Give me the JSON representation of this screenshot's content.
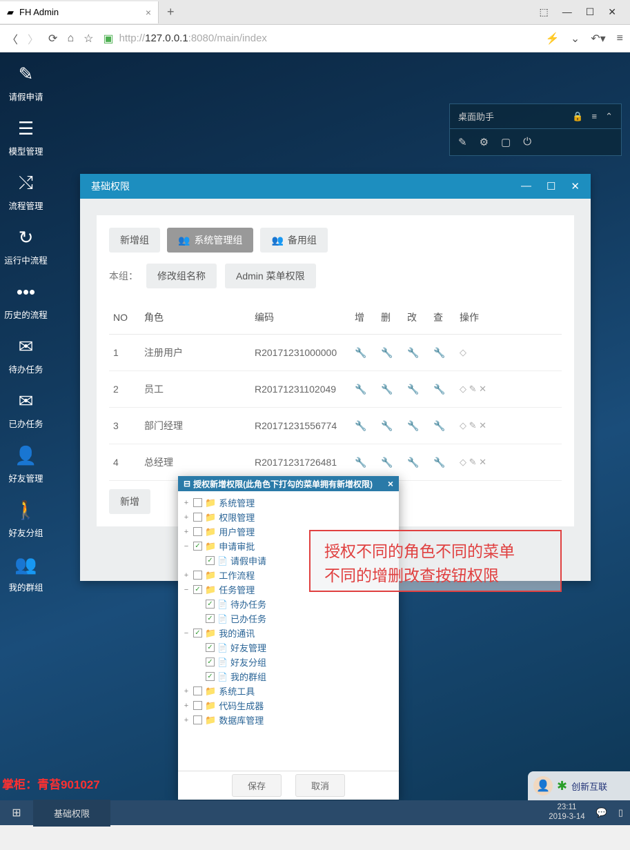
{
  "browser": {
    "tab_title": "FH Admin",
    "url": "http://127.0.0.1:8080/main/index",
    "url_prefix": "http://",
    "url_host": "127.0.0.1",
    "url_path": ":8080/main/index"
  },
  "sidebar": {
    "items": [
      {
        "label": "请假申请",
        "icon": "edit-icon"
      },
      {
        "label": "模型管理",
        "icon": "server-icon"
      },
      {
        "label": "流程管理",
        "icon": "shuffle-icon"
      },
      {
        "label": "运行中流程",
        "icon": "refresh-icon"
      },
      {
        "label": "历史的流程",
        "icon": "dots-icon"
      },
      {
        "label": "待办任务",
        "icon": "envelope-icon"
      },
      {
        "label": "已办任务",
        "icon": "envelope-open-icon"
      },
      {
        "label": "好友管理",
        "icon": "user-icon"
      },
      {
        "label": "好友分组",
        "icon": "person-icon"
      },
      {
        "label": "我的群组",
        "icon": "users-icon"
      }
    ]
  },
  "helper": {
    "title": "桌面助手"
  },
  "window": {
    "title": "基础权限",
    "tabs": {
      "new_group": "新增组",
      "sys_admin": "系统管理组",
      "backup": "备用组"
    },
    "group_label": "本组：",
    "rename": "修改组名称",
    "admin_menu": "Admin 菜单权限",
    "columns": {
      "no": "NO",
      "role": "角色",
      "code": "编码",
      "add": "增",
      "del": "删",
      "mod": "改",
      "view": "查",
      "op": "操作"
    },
    "rows": [
      {
        "no": "1",
        "role": "注册用户",
        "code": "R20171231000000",
        "ops": "tag"
      },
      {
        "no": "2",
        "role": "员工",
        "code": "R20171231102049",
        "ops": "tag-edit-del"
      },
      {
        "no": "3",
        "role": "部门经理",
        "code": "R20171231556774",
        "ops": "tag-edit-del"
      },
      {
        "no": "4",
        "role": "总经理",
        "code": "R20171231726481",
        "ops": "tag-edit-del"
      }
    ],
    "add_new": "新增"
  },
  "modal": {
    "title": "授权新增权限(此角色下打勾的菜单拥有新增权限)",
    "save": "保存",
    "cancel": "取消",
    "tree": [
      {
        "label": "系统管理",
        "indent": 0,
        "checked": false,
        "exp": "+",
        "type": "folder"
      },
      {
        "label": "权限管理",
        "indent": 0,
        "checked": false,
        "exp": "+",
        "type": "folder"
      },
      {
        "label": "用户管理",
        "indent": 0,
        "checked": false,
        "exp": "+",
        "type": "folder"
      },
      {
        "label": "申请审批",
        "indent": 0,
        "checked": true,
        "exp": "−",
        "type": "folder"
      },
      {
        "label": "请假申请",
        "indent": 1,
        "checked": true,
        "exp": "",
        "type": "file"
      },
      {
        "label": "工作流程",
        "indent": 0,
        "checked": false,
        "exp": "+",
        "type": "folder"
      },
      {
        "label": "任务管理",
        "indent": 0,
        "checked": true,
        "exp": "−",
        "type": "folder"
      },
      {
        "label": "待办任务",
        "indent": 1,
        "checked": true,
        "exp": "",
        "type": "file"
      },
      {
        "label": "已办任务",
        "indent": 1,
        "checked": true,
        "exp": "",
        "type": "file"
      },
      {
        "label": "我的通讯",
        "indent": 0,
        "checked": true,
        "exp": "−",
        "type": "folder"
      },
      {
        "label": "好友管理",
        "indent": 1,
        "checked": true,
        "exp": "",
        "type": "file"
      },
      {
        "label": "好友分组",
        "indent": 1,
        "checked": true,
        "exp": "",
        "type": "file"
      },
      {
        "label": "我的群组",
        "indent": 1,
        "checked": true,
        "exp": "",
        "type": "file"
      },
      {
        "label": "系统工具",
        "indent": 0,
        "checked": false,
        "exp": "+",
        "type": "folder"
      },
      {
        "label": "代码生成器",
        "indent": 0,
        "checked": false,
        "exp": "+",
        "type": "folder"
      },
      {
        "label": "数据库管理",
        "indent": 0,
        "checked": false,
        "exp": "+",
        "type": "folder"
      }
    ]
  },
  "annotation": {
    "line1": "授权不同的角色不同的菜单",
    "line2": "不同的增删改查按钮权限"
  },
  "watermark": "掌柜：青苔901027",
  "taskbar": {
    "item": "基础权限",
    "time": "23:11",
    "date": "2019-3-14"
  },
  "corner": "创新互联"
}
